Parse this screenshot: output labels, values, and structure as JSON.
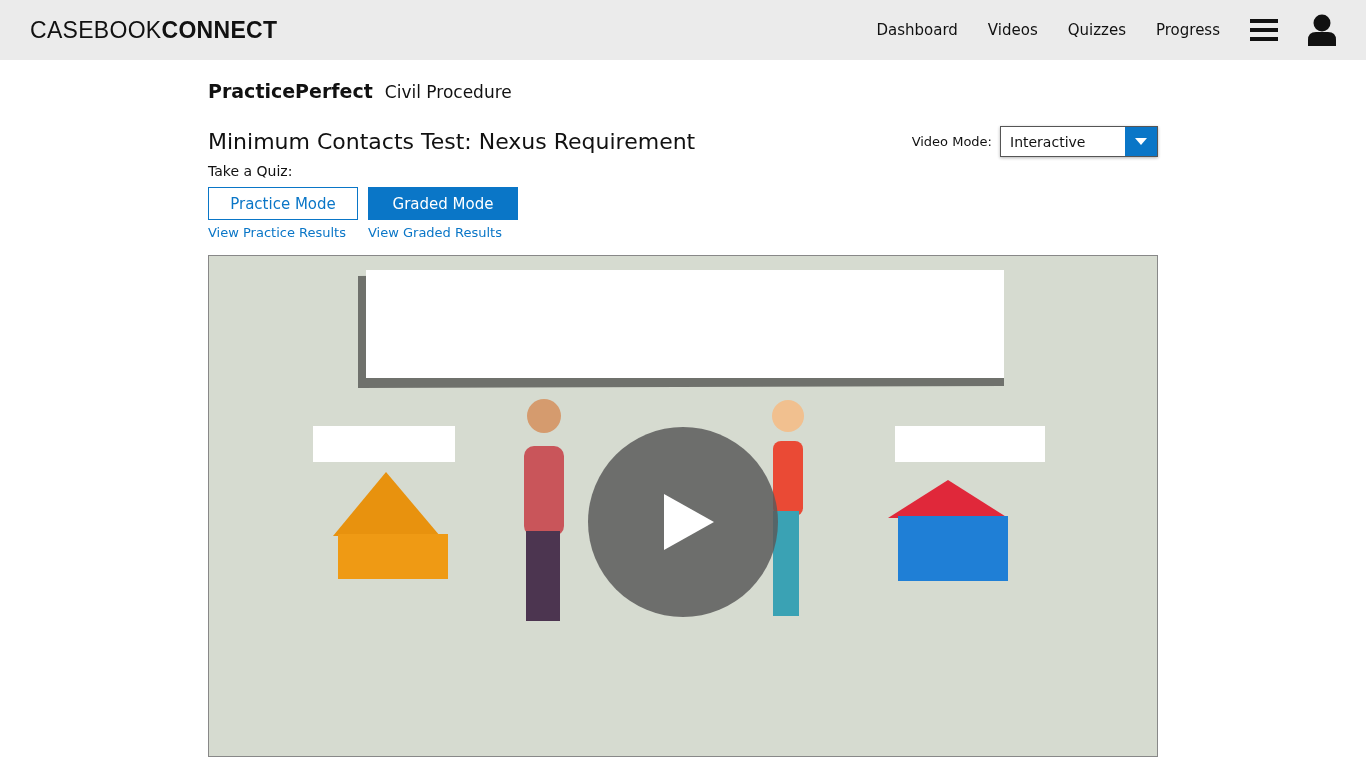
{
  "header": {
    "logo": "CASEBOOK**CONNECT**",
    "nav": [
      {
        "label": "Dashboard"
      },
      {
        "label": "Videos"
      },
      {
        "label": "Quizzes"
      },
      {
        "label": "Progress"
      }
    ]
  },
  "breadcrumb": {
    "product": "PracticePerfect",
    "subject": "Civil Procedure"
  },
  "lesson": {
    "title": "Minimum Contacts Test: Nexus Requirement",
    "video_mode": {
      "label": "Video Mode:",
      "value": "Interactive"
    }
  },
  "quiz": {
    "label": "Take a Quiz:",
    "modes": [
      {
        "label": "Practice Mode",
        "kind": "outline",
        "link": "View Practice Results"
      },
      {
        "label": "Graded Mode",
        "kind": "filled",
        "link": "View Graded Results"
      }
    ]
  }
}
